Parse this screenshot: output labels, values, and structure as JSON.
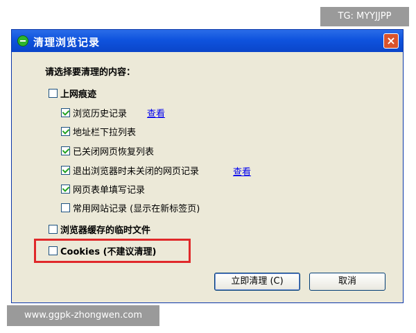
{
  "watermark_top": "TG: MYYJJPP",
  "watermark_bottom": "www.ggpk-zhongwen.com",
  "dialog": {
    "title": "清理浏览记录",
    "close_glyph": "×",
    "heading": "请选择要清理的内容：",
    "groups": {
      "history_label": "上网痕迹",
      "history_checked": false,
      "items": [
        {
          "label": "浏览历史记录",
          "checked": true,
          "link": "查看"
        },
        {
          "label": "地址栏下拉列表",
          "checked": true
        },
        {
          "label": "已关闭网页恢复列表",
          "checked": true
        },
        {
          "label": "退出浏览器时未关闭的网页记录",
          "checked": true,
          "link": "查看"
        },
        {
          "label": "网页表单填写记录",
          "checked": true
        },
        {
          "label": "常用网站记录 (显示在新标签页)",
          "checked": false
        }
      ],
      "cache_label": "浏览器缓存的临时文件",
      "cache_checked": false,
      "cookies_label": "Cookies (不建议清理)",
      "cookies_checked": false
    },
    "buttons": {
      "clean_now": "立即清理 (C)",
      "cancel": "取消"
    }
  }
}
